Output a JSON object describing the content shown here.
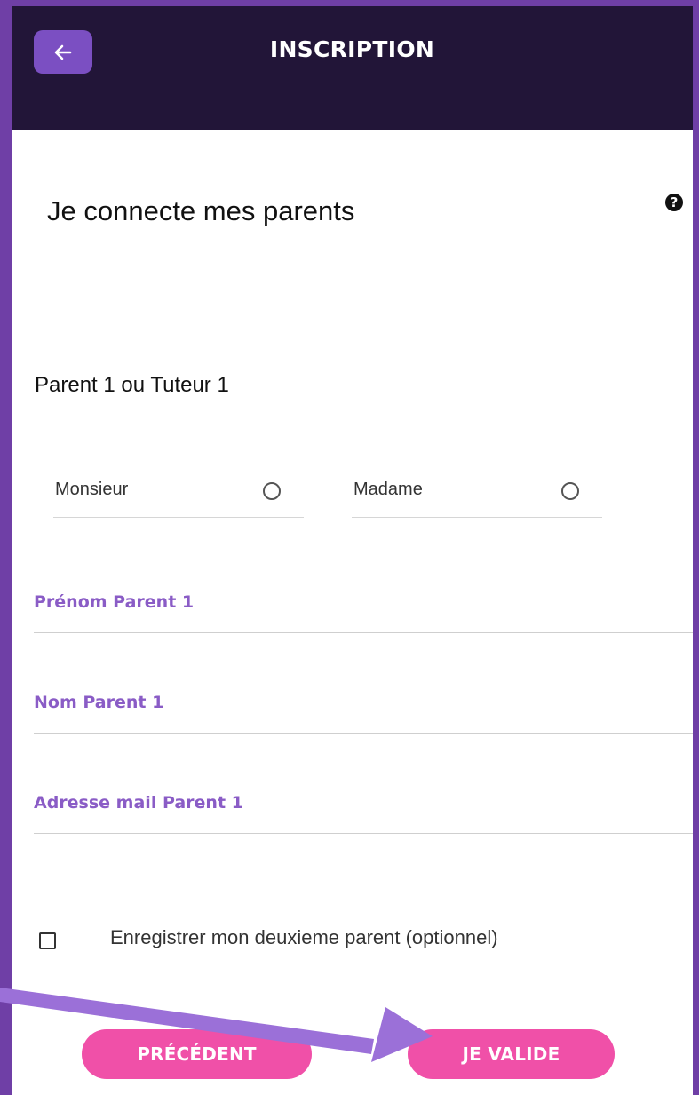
{
  "header": {
    "title": "INSCRIPTION",
    "back_icon": "arrow-left-icon"
  },
  "page": {
    "title": "Je connecte mes parents",
    "help_icon": "?"
  },
  "section": {
    "title": "Parent 1 ou Tuteur 1"
  },
  "civility": {
    "options": [
      {
        "label": "Monsieur"
      },
      {
        "label": "Madame"
      }
    ]
  },
  "fields": [
    {
      "label": "Prénom Parent 1",
      "value": ""
    },
    {
      "label": "Nom Parent 1",
      "value": ""
    },
    {
      "label": "Adresse mail Parent 1",
      "value": ""
    }
  ],
  "second_parent": {
    "label": "Enregistrer mon deuxieme parent (optionnel)",
    "checked": false
  },
  "buttons": {
    "previous": "PRÉCÉDENT",
    "validate": "JE VALIDE"
  },
  "colors": {
    "background": "#6f3fa6",
    "header_bg": "#221538",
    "back_button": "#7b4fc2",
    "field_label": "#8a5cc6",
    "button_pink": "#f050a8",
    "annotation_arrow": "#9b70d8"
  }
}
